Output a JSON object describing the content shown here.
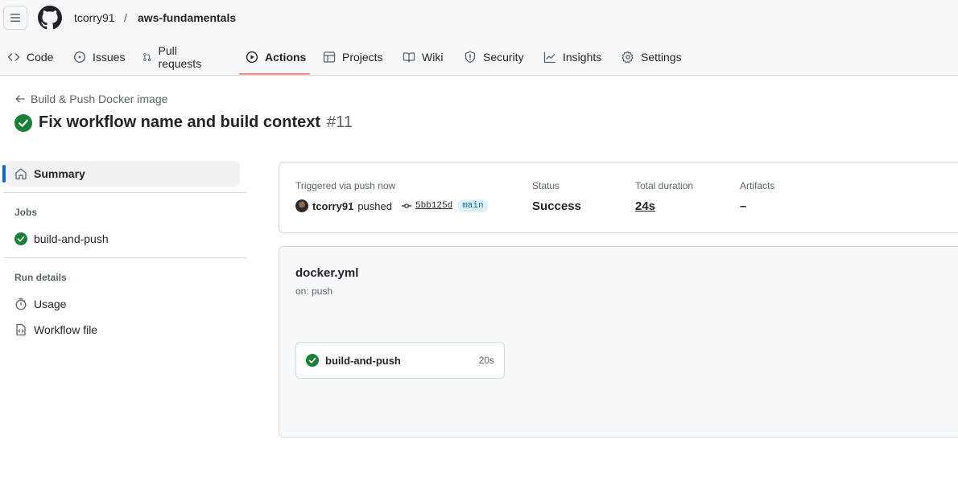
{
  "header": {
    "owner": "tcorry91",
    "separator": "/",
    "repo": "aws-fundamentals"
  },
  "nav": {
    "tabs": [
      {
        "label": "Code",
        "icon": "code-icon"
      },
      {
        "label": "Issues",
        "icon": "issue-icon"
      },
      {
        "label": "Pull requests",
        "icon": "pull-request-icon"
      },
      {
        "label": "Actions",
        "icon": "play-icon",
        "active": true
      },
      {
        "label": "Projects",
        "icon": "table-icon"
      },
      {
        "label": "Wiki",
        "icon": "book-icon"
      },
      {
        "label": "Security",
        "icon": "shield-icon"
      },
      {
        "label": "Insights",
        "icon": "graph-icon"
      },
      {
        "label": "Settings",
        "icon": "gear-icon"
      }
    ]
  },
  "run": {
    "workflow_back": "Build & Push Docker image",
    "title": "Fix workflow name and build context",
    "number": "#11",
    "status_color": "#1a7f37"
  },
  "sidebar": {
    "summary": "Summary",
    "jobs_heading": "Jobs",
    "jobs": [
      "build-and-push"
    ],
    "details_heading": "Run details",
    "usage": "Usage",
    "workflow_file": "Workflow file"
  },
  "summary": {
    "triggered_label": "Triggered via push now",
    "user": "tcorry91",
    "action": "pushed",
    "commit": "5bb125d",
    "branch": "main",
    "status_label": "Status",
    "status_value": "Success",
    "duration_label": "Total duration",
    "duration_value": "24s",
    "artifacts_label": "Artifacts",
    "artifacts_value": "–"
  },
  "workflow": {
    "file": "docker.yml",
    "trigger": "on: push",
    "job_name": "build-and-push",
    "job_time": "20s"
  }
}
